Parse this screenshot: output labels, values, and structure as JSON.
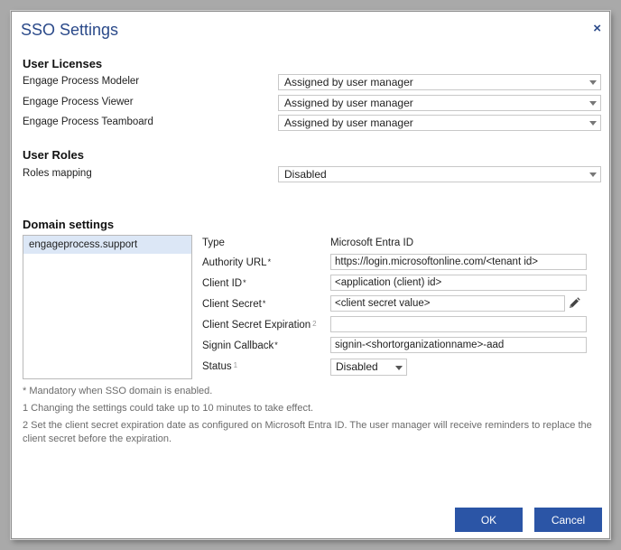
{
  "dialog": {
    "title": "SSO Settings",
    "close_glyph": "×",
    "accent_color": "#2b4a8a",
    "button_color": "#2b55a6"
  },
  "user_licenses": {
    "heading": "User Licenses",
    "rows": [
      {
        "label": "Engage Process Modeler",
        "value": "Assigned by user manager"
      },
      {
        "label": "Engage Process Viewer",
        "value": "Assigned by user manager"
      },
      {
        "label": "Engage Process Teamboard",
        "value": "Assigned by user manager"
      }
    ]
  },
  "user_roles": {
    "heading": "User Roles",
    "rows": [
      {
        "label": "Roles mapping",
        "value": "Disabled"
      }
    ]
  },
  "domain_settings": {
    "heading": "Domain settings",
    "domains": [
      "engageprocess.support"
    ],
    "type_label": "Type",
    "type_value": "Microsoft Entra ID",
    "authority_url_label": "Authority URL",
    "authority_url_value": "https://login.microsoftonline.com/<tenant id>",
    "client_id_label": "Client ID",
    "client_id_value": "<application (client) id>",
    "client_secret_label": "Client Secret",
    "client_secret_value": "<client secret value>",
    "client_secret_expiration_label": "Client Secret Expiration",
    "client_secret_expiration_value": "",
    "signin_callback_label": "Signin Callback",
    "signin_callback_value": "signin-<shortorganizationname>-aad",
    "status_label": "Status",
    "status_value": "Disabled",
    "required_mark": "*",
    "footnote_2": "2",
    "footnote_1": "1"
  },
  "notes": {
    "mandatory": "*  Mandatory when SSO domain is enabled.",
    "note1": "1  Changing the settings could take up to 10 minutes to take effect.",
    "note2": "2  Set the client secret expiration date as configured on Microsoft Entra ID. The user manager will receive reminders to replace the client secret before the expiration."
  },
  "buttons": {
    "ok": "OK",
    "cancel": "Cancel"
  }
}
